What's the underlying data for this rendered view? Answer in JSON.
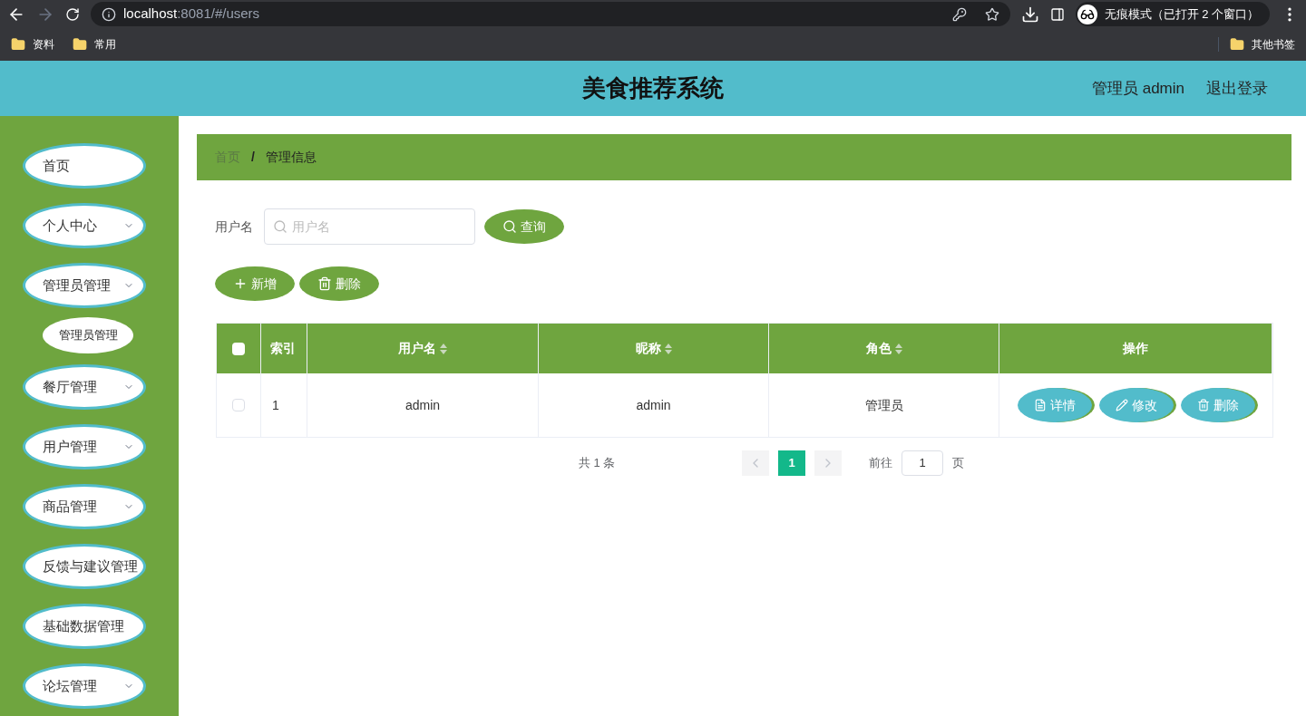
{
  "browser": {
    "url_host": "localhost",
    "url_rest": ":8081/#/users",
    "incognito": "无痕模式（已打开 2 个窗口）",
    "bookmarks": [
      {
        "label": "资料"
      },
      {
        "label": "常用"
      }
    ],
    "other_bookmarks": "其他书签"
  },
  "header": {
    "title": "美食推荐系统",
    "user": "管理员 admin",
    "logout": "退出登录"
  },
  "sidebar": {
    "items": [
      {
        "label": "首页",
        "kind": "link"
      },
      {
        "label": "个人中心",
        "kind": "submenu"
      },
      {
        "label": "管理员管理",
        "kind": "submenu",
        "children": [
          {
            "label": "管理员管理"
          }
        ]
      },
      {
        "label": "餐厅管理",
        "kind": "submenu"
      },
      {
        "label": "用户管理",
        "kind": "submenu"
      },
      {
        "label": "商品管理",
        "kind": "submenu"
      },
      {
        "label": "反馈与建议管理",
        "kind": "link"
      },
      {
        "label": "基础数据管理",
        "kind": "link"
      },
      {
        "label": "论坛管理",
        "kind": "submenu"
      }
    ]
  },
  "breadcrumb": [
    {
      "label": "首页",
      "selected": false
    },
    {
      "label": "管理信息",
      "selected": true
    }
  ],
  "breadcrumb_separator": "/",
  "search": {
    "label": "用户名",
    "placeholder": "用户名",
    "button": "查询"
  },
  "actions": [
    {
      "label": "新增",
      "kind": "add"
    },
    {
      "label": "删除",
      "kind": "delete"
    }
  ],
  "table": {
    "select_all_checked": false,
    "columns": [
      {
        "label": "索引",
        "sortable": false
      },
      {
        "label": "用户名",
        "sortable": true
      },
      {
        "label": "昵称",
        "sortable": true
      },
      {
        "label": "角色",
        "sortable": true
      },
      {
        "label": "操作",
        "sortable": false
      }
    ],
    "rows": [
      {
        "checked": false,
        "cells": [
          "1",
          "admin",
          "admin",
          "管理员"
        ],
        "buttons": [
          {
            "label": "详情",
            "kind": "detail"
          },
          {
            "label": "修改",
            "kind": "edit"
          },
          {
            "label": "删除",
            "kind": "delete"
          }
        ]
      }
    ]
  },
  "pagination": {
    "total": "共 1 条",
    "pages": [
      {
        "label": "1",
        "selected": true
      }
    ],
    "goto_label": "前往",
    "goto_value": "1",
    "page_suffix": "页"
  }
}
